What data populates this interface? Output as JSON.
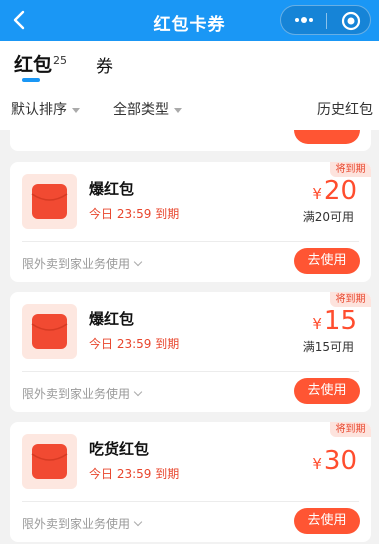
{
  "nav": {
    "title": "红包卡券"
  },
  "tabs": {
    "main_label": "红包",
    "main_count": "25",
    "second_label": "券"
  },
  "filters": {
    "default_sort": "默认排序",
    "all_types": "全部类型",
    "history": "历史红包"
  },
  "colors": {
    "nav_blue": "#1a97f5",
    "accent_red": "#ff5533",
    "badge_bg": "#fde3dd"
  },
  "cards": [
    {
      "badge": "将到期",
      "title": "爆红包",
      "expiry": "今日 23:59 到期",
      "currency": "¥",
      "amount": "20",
      "condition": "满20可用",
      "scope": "限外卖到家业务使用",
      "action": "去使用"
    },
    {
      "badge": "将到期",
      "title": "爆红包",
      "expiry": "今日 23:59 到期",
      "currency": "¥",
      "amount": "15",
      "condition": "满15可用",
      "scope": "限外卖到家业务使用",
      "action": "去使用"
    },
    {
      "badge": "将到期",
      "title": "吃货红包",
      "expiry": "今日 23:59 到期",
      "currency": "¥",
      "amount": "30",
      "condition": "",
      "scope": "限外卖到家业务使用",
      "action": "去使用"
    }
  ]
}
